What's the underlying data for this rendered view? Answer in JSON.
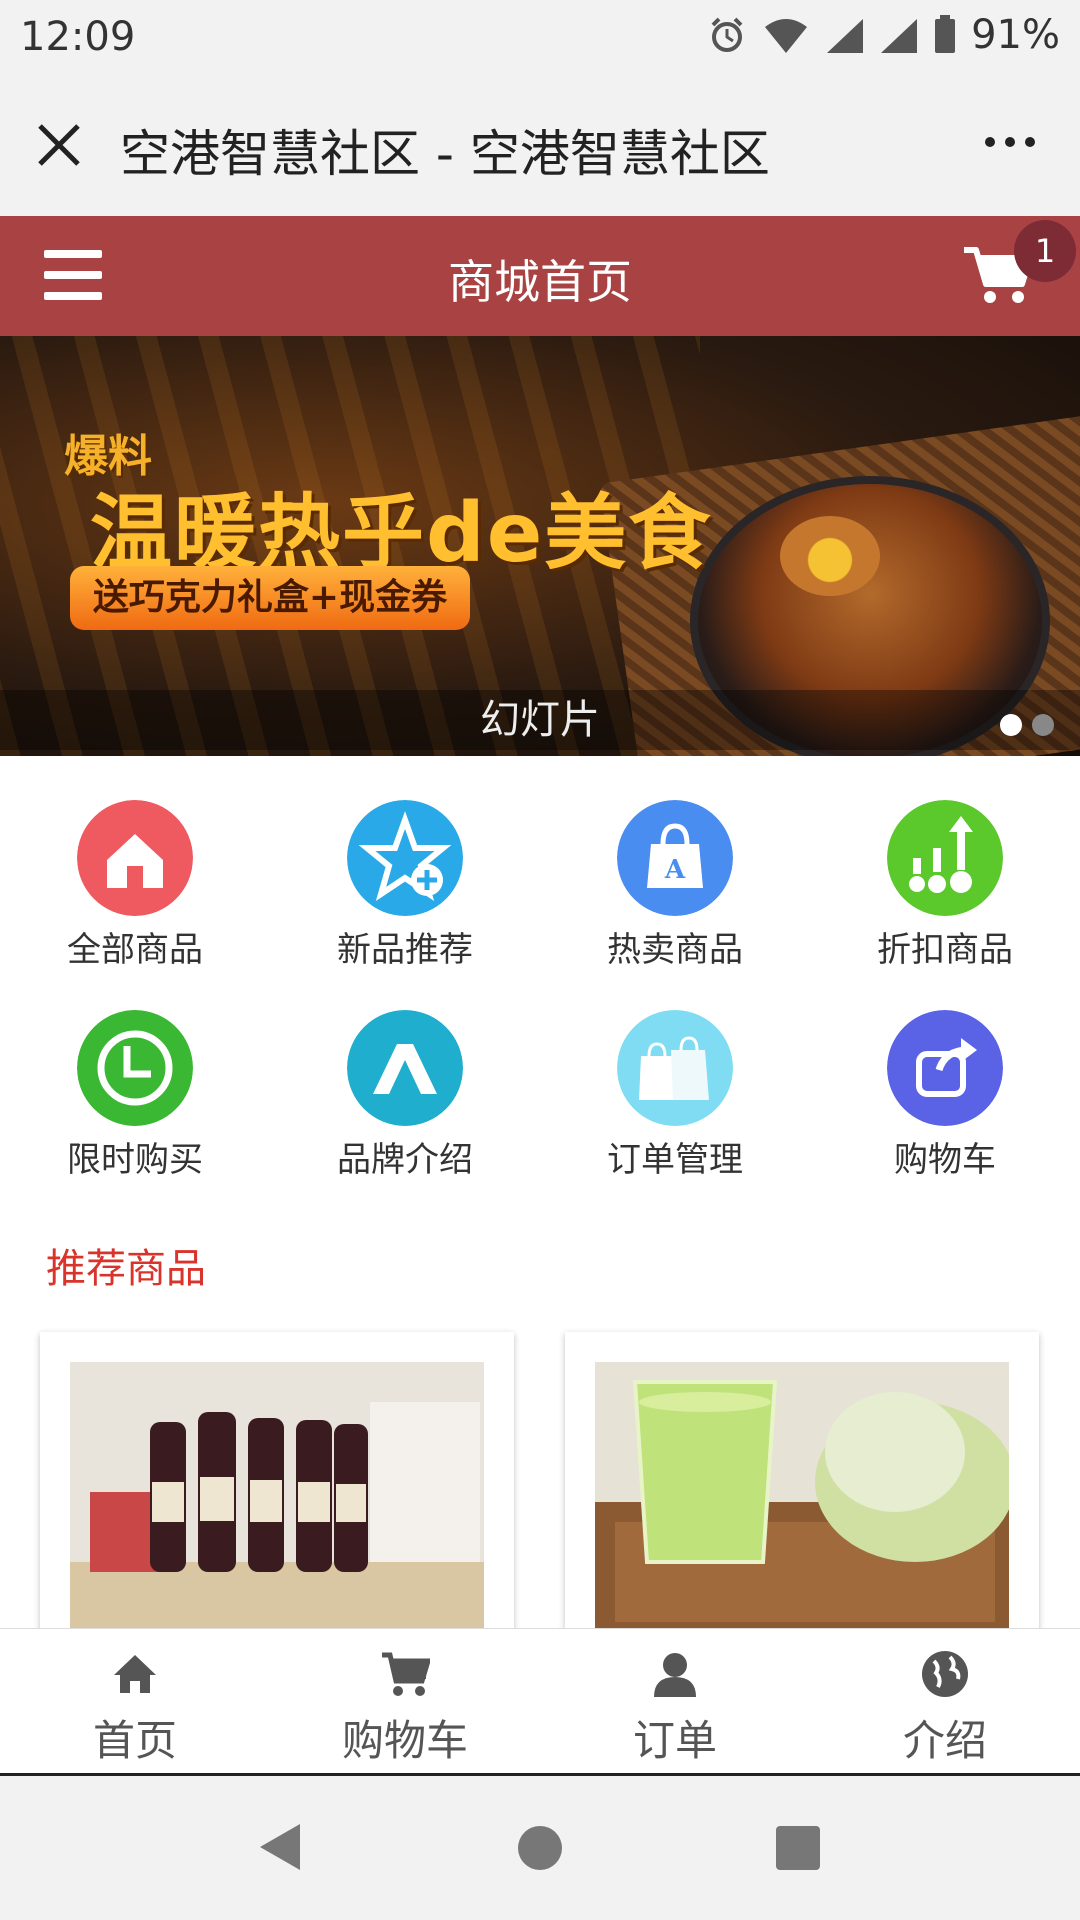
{
  "status_bar": {
    "time": "12:09",
    "battery": "91%"
  },
  "browser": {
    "title": "空港智慧社区 - 空港智慧社区"
  },
  "header": {
    "title": "商城首页",
    "cart_count": "1"
  },
  "banner": {
    "promo_line1": "爆料",
    "promo_line2": "温暖热乎de美食",
    "promo_button": "送巧克力礼盒+现金券",
    "caption": "幻灯片",
    "slide_count": 2,
    "active_slide": 1
  },
  "categories": [
    {
      "label": "全部商品",
      "icon": "house-icon",
      "color": "#ee5a5f"
    },
    {
      "label": "新品推荐",
      "icon": "star-plus-icon",
      "color": "#2aa9e8"
    },
    {
      "label": "热卖商品",
      "icon": "shopping-bag-icon",
      "color": "#4a8df0"
    },
    {
      "label": "折扣商品",
      "icon": "growth-arrow-icon",
      "color": "#5bc82b"
    },
    {
      "label": "限时购买",
      "icon": "clock-icon",
      "color": "#3ab833"
    },
    {
      "label": "品牌介绍",
      "icon": "brand-icon",
      "color": "#1faecd"
    },
    {
      "label": "订单管理",
      "icon": "bags-icon",
      "color": "#7fdcf2"
    },
    {
      "label": "购物车",
      "icon": "share-icon",
      "color": "#5a62e6"
    }
  ],
  "recommended": {
    "title": "推荐商品"
  },
  "tabbar": [
    {
      "label": "首页",
      "icon": "home-icon"
    },
    {
      "label": "购物车",
      "icon": "cart-icon"
    },
    {
      "label": "订单",
      "icon": "user-icon"
    },
    {
      "label": "介绍",
      "icon": "globe-icon"
    }
  ]
}
